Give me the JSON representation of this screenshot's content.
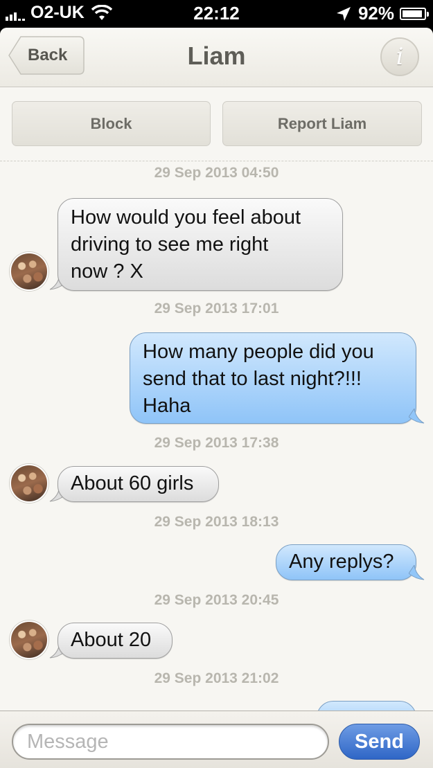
{
  "status_bar": {
    "carrier": "O2-UK",
    "time": "22:12",
    "battery": "92%",
    "battery_level": 0.92,
    "icons": [
      "signal-icon",
      "wifi-icon",
      "location-arrow-icon",
      "battery-icon"
    ]
  },
  "nav": {
    "back_label": "Back",
    "title": "Liam",
    "info_icon": "i"
  },
  "actions": {
    "block_label": "Block",
    "report_label": "Report Liam"
  },
  "timestamps": [
    "29 Sep 2013 04:50",
    "29 Sep 2013 17:01",
    "29 Sep 2013 17:38",
    "29 Sep 2013 18:13",
    "29 Sep 2013 20:45",
    "29 Sep 2013 21:02"
  ],
  "messages": [
    {
      "direction": "incoming",
      "lines": [
        "How would you feel about",
        "driving to see me right",
        "now ? X"
      ]
    },
    {
      "direction": "outgoing",
      "lines": [
        "How many people did you",
        "send that to last night?!!!",
        "Haha"
      ]
    },
    {
      "direction": "incoming",
      "lines": [
        "About 60 girls"
      ]
    },
    {
      "direction": "outgoing",
      "lines": [
        "Any replys?"
      ]
    },
    {
      "direction": "incoming",
      "lines": [
        "About 20"
      ]
    },
    {
      "direction": "outgoing",
      "lines": [
        "..."
      ]
    }
  ],
  "composer": {
    "placeholder": "Message",
    "value": "",
    "send_label": "Send"
  },
  "colors": {
    "incoming_bubble": "#dcdcdc",
    "outgoing_bubble": "#8fc4f8",
    "send_button": "#2f66c6",
    "background": "#f7f6f2"
  }
}
